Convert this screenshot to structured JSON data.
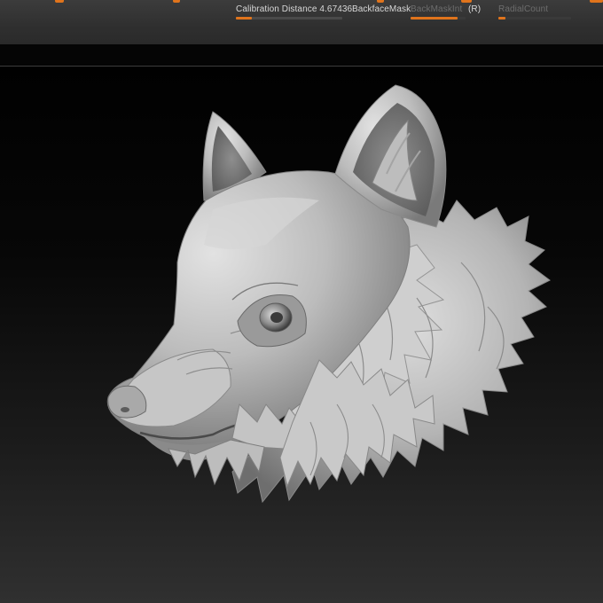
{
  "toolbar": {
    "calibration_label": "Calibration Distance 4.67436",
    "calibration_value": 0.15,
    "backface_label": "BackfaceMask",
    "backmaskint_label": "BackMaskInt",
    "backmaskint_value": 0.85,
    "r_label": "(R)",
    "radialcount_label": "RadialCount",
    "radialcount_value": 0.1,
    "accent_color": "#e0741c"
  },
  "viewport": {
    "model": "wolf-head-sculpt",
    "background_top": "#010101",
    "background_bottom": "#303030",
    "material_color": "#b9b9b9"
  }
}
